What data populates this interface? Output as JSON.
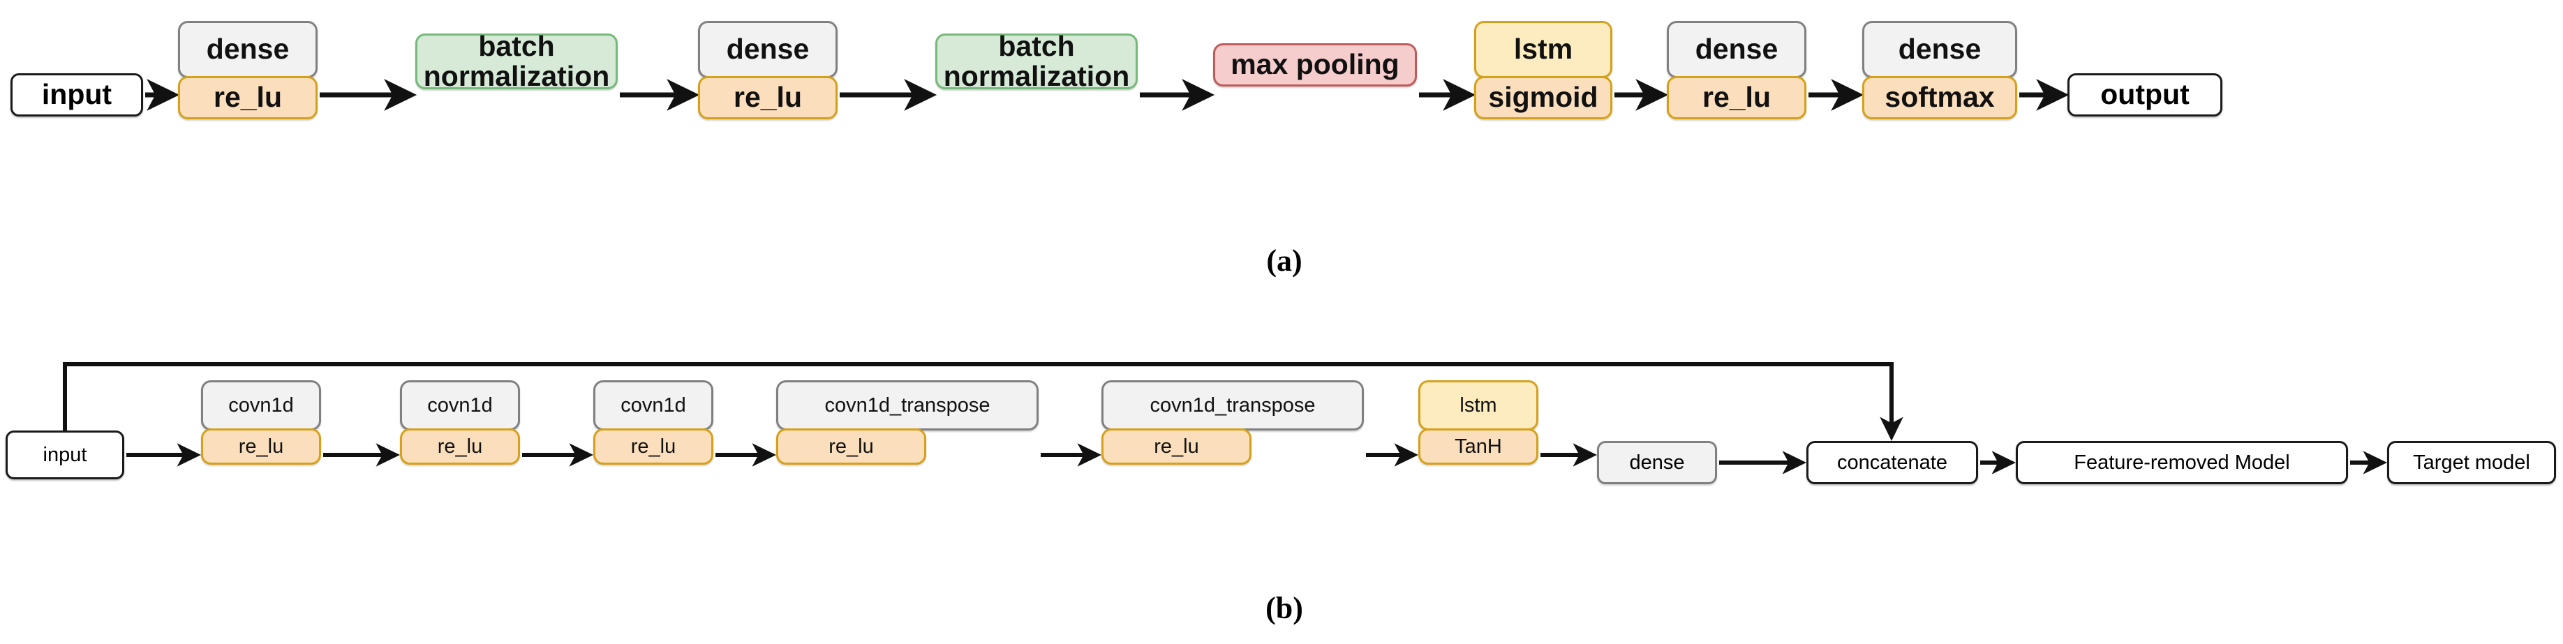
{
  "figure": {
    "panels": [
      {
        "id": "a",
        "caption": "(a)",
        "nodes": [
          {
            "kind": "plain",
            "label": "input"
          },
          {
            "kind": "stack",
            "layer": "dense",
            "activation": "re_lu",
            "color": "gray"
          },
          {
            "kind": "single",
            "layer": "batch normalization",
            "color": "green"
          },
          {
            "kind": "stack",
            "layer": "dense",
            "activation": "re_lu",
            "color": "gray"
          },
          {
            "kind": "single",
            "layer": "batch normalization",
            "color": "green"
          },
          {
            "kind": "single",
            "layer": "max pooling",
            "color": "red"
          },
          {
            "kind": "stack",
            "layer": "lstm",
            "activation": "sigmoid",
            "color": "amber"
          },
          {
            "kind": "stack",
            "layer": "dense",
            "activation": "re_lu",
            "color": "gray"
          },
          {
            "kind": "stack",
            "layer": "dense",
            "activation": "softmax",
            "color": "gray"
          },
          {
            "kind": "plain",
            "label": "output"
          }
        ]
      },
      {
        "id": "b",
        "caption": "(b)",
        "nodes": [
          {
            "kind": "plain",
            "label": "input"
          },
          {
            "kind": "stack",
            "layer": "covn1d",
            "activation": "re_lu",
            "color": "gray"
          },
          {
            "kind": "stack",
            "layer": "covn1d",
            "activation": "re_lu",
            "color": "gray"
          },
          {
            "kind": "stack",
            "layer": "covn1d",
            "activation": "re_lu",
            "color": "gray"
          },
          {
            "kind": "stack",
            "layer": "covn1d_transpose",
            "activation": "re_lu",
            "color": "gray"
          },
          {
            "kind": "stack",
            "layer": "covn1d_transpose",
            "activation": "re_lu",
            "color": "gray"
          },
          {
            "kind": "stack",
            "layer": "lstm",
            "activation": "TanH",
            "color": "amber"
          },
          {
            "kind": "single-gray",
            "layer": "dense",
            "color": "gray"
          },
          {
            "kind": "plain",
            "label": "concatenate"
          },
          {
            "kind": "plain",
            "label": "Feature-removed Model"
          },
          {
            "kind": "plain",
            "label": "Target model"
          }
        ],
        "skip_connection": {
          "from": "input",
          "to": "concatenate"
        }
      }
    ]
  },
  "palette": {
    "gray_border": "#808080",
    "gray_fill": "#f2f2f2",
    "green_border": "#76b97a",
    "green_fill": "#d7ead8",
    "red_border": "#bf5b5b",
    "red_fill": "#f6cdcd",
    "amber_border": "#d6a11a",
    "amber_fill": "#fcecbf",
    "activation_border": "#d6a11a",
    "activation_fill": "#fbdfbd",
    "plain_border": "#1a1a1a",
    "plain_fill": "#ffffff",
    "arrow": "#111111",
    "text": "#111111",
    "background": "#ffffff"
  }
}
